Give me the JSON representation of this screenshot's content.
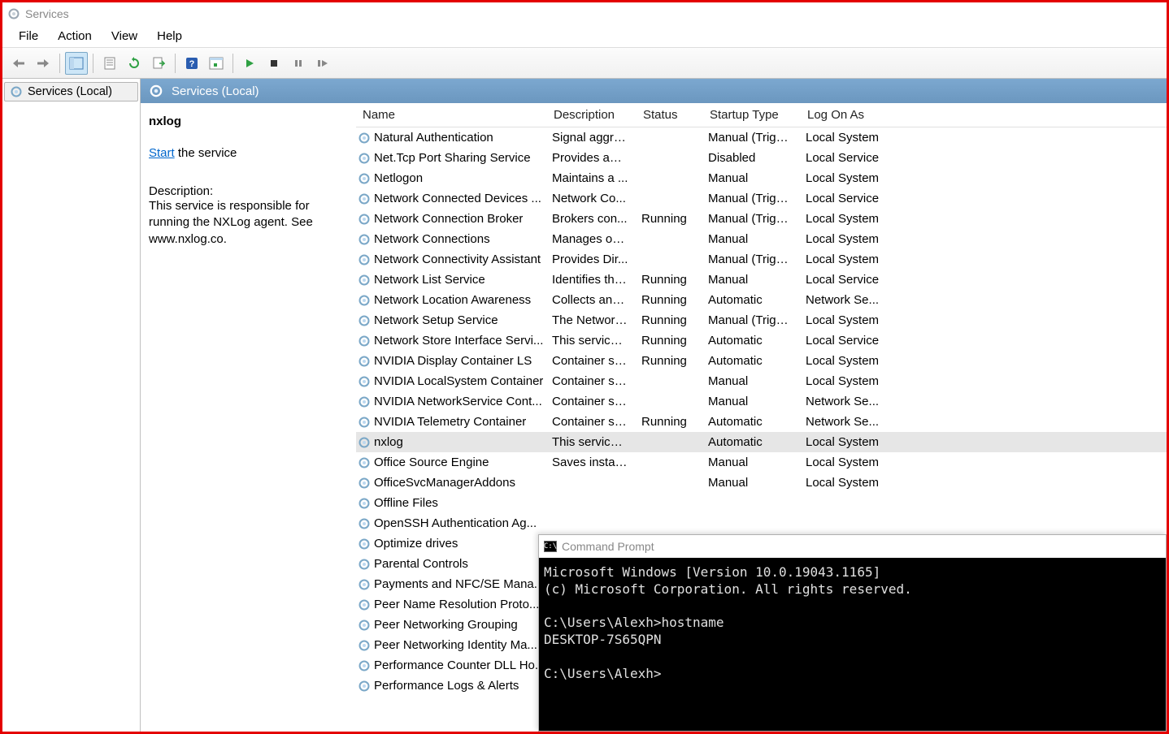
{
  "window": {
    "title": "Services"
  },
  "menu": {
    "file": "File",
    "action": "Action",
    "view": "View",
    "help": "Help"
  },
  "tree": {
    "root": "Services (Local)"
  },
  "header": {
    "title": "Services (Local)"
  },
  "detail": {
    "selected_name": "nxlog",
    "start_link": "Start",
    "start_rest": " the service",
    "desc_label": "Description:",
    "desc_text": "This service is responsible for running the NXLog agent. See www.nxlog.co."
  },
  "columns": {
    "name": "Name",
    "description": "Description",
    "status": "Status",
    "startup": "Startup Type",
    "logon": "Log On As"
  },
  "services": [
    {
      "name": "Natural Authentication",
      "desc": "Signal aggre...",
      "status": "",
      "startup": "Manual (Trigg...",
      "logon": "Local System"
    },
    {
      "name": "Net.Tcp Port Sharing Service",
      "desc": "Provides abil...",
      "status": "",
      "startup": "Disabled",
      "logon": "Local Service"
    },
    {
      "name": "Netlogon",
      "desc": "Maintains a ...",
      "status": "",
      "startup": "Manual",
      "logon": "Local System"
    },
    {
      "name": "Network Connected Devices ...",
      "desc": "Network Co...",
      "status": "",
      "startup": "Manual (Trigg...",
      "logon": "Local Service"
    },
    {
      "name": "Network Connection Broker",
      "desc": "Brokers con...",
      "status": "Running",
      "startup": "Manual (Trigg...",
      "logon": "Local System"
    },
    {
      "name": "Network Connections",
      "desc": "Manages ob...",
      "status": "",
      "startup": "Manual",
      "logon": "Local System"
    },
    {
      "name": "Network Connectivity Assistant",
      "desc": "Provides Dir...",
      "status": "",
      "startup": "Manual (Trigg...",
      "logon": "Local System"
    },
    {
      "name": "Network List Service",
      "desc": "Identifies the...",
      "status": "Running",
      "startup": "Manual",
      "logon": "Local Service"
    },
    {
      "name": "Network Location Awareness",
      "desc": "Collects and ...",
      "status": "Running",
      "startup": "Automatic",
      "logon": "Network Se..."
    },
    {
      "name": "Network Setup Service",
      "desc": "The Network...",
      "status": "Running",
      "startup": "Manual (Trigg...",
      "logon": "Local System"
    },
    {
      "name": "Network Store Interface Servi...",
      "desc": "This service ...",
      "status": "Running",
      "startup": "Automatic",
      "logon": "Local Service"
    },
    {
      "name": "NVIDIA Display Container LS",
      "desc": "Container se...",
      "status": "Running",
      "startup": "Automatic",
      "logon": "Local System"
    },
    {
      "name": "NVIDIA LocalSystem Container",
      "desc": "Container se...",
      "status": "",
      "startup": "Manual",
      "logon": "Local System"
    },
    {
      "name": "NVIDIA NetworkService Cont...",
      "desc": "Container se...",
      "status": "",
      "startup": "Manual",
      "logon": "Network Se..."
    },
    {
      "name": "NVIDIA Telemetry Container",
      "desc": "Container se...",
      "status": "Running",
      "startup": "Automatic",
      "logon": "Network Se..."
    },
    {
      "name": "nxlog",
      "desc": "This service i...",
      "status": "",
      "startup": "Automatic",
      "logon": "Local System",
      "selected": true
    },
    {
      "name": "Office  Source Engine",
      "desc": "Saves install...",
      "status": "",
      "startup": "Manual",
      "logon": "Local System"
    },
    {
      "name": "OfficeSvcManagerAddons",
      "desc": "",
      "status": "",
      "startup": "Manual",
      "logon": "Local System"
    },
    {
      "name": "Offline Files",
      "desc": "",
      "status": "",
      "startup": "",
      "logon": ""
    },
    {
      "name": "OpenSSH Authentication Ag...",
      "desc": "",
      "status": "",
      "startup": "",
      "logon": ""
    },
    {
      "name": "Optimize drives",
      "desc": "",
      "status": "",
      "startup": "",
      "logon": ""
    },
    {
      "name": "Parental Controls",
      "desc": "",
      "status": "",
      "startup": "",
      "logon": ""
    },
    {
      "name": "Payments and NFC/SE Mana...",
      "desc": "",
      "status": "",
      "startup": "",
      "logon": ""
    },
    {
      "name": "Peer Name Resolution Proto...",
      "desc": "",
      "status": "",
      "startup": "",
      "logon": ""
    },
    {
      "name": "Peer Networking Grouping",
      "desc": "",
      "status": "",
      "startup": "",
      "logon": ""
    },
    {
      "name": "Peer Networking Identity Ma...",
      "desc": "",
      "status": "",
      "startup": "",
      "logon": ""
    },
    {
      "name": "Performance Counter DLL Ho...",
      "desc": "",
      "status": "",
      "startup": "",
      "logon": ""
    },
    {
      "name": "Performance Logs & Alerts",
      "desc": "",
      "status": "",
      "startup": "",
      "logon": ""
    }
  ],
  "cmd": {
    "title": "Command Prompt",
    "lines": "Microsoft Windows [Version 10.0.19043.1165]\n(c) Microsoft Corporation. All rights reserved.\n\nC:\\Users\\Alexh>hostname\nDESKTOP-7S65QPN\n\nC:\\Users\\Alexh>"
  }
}
